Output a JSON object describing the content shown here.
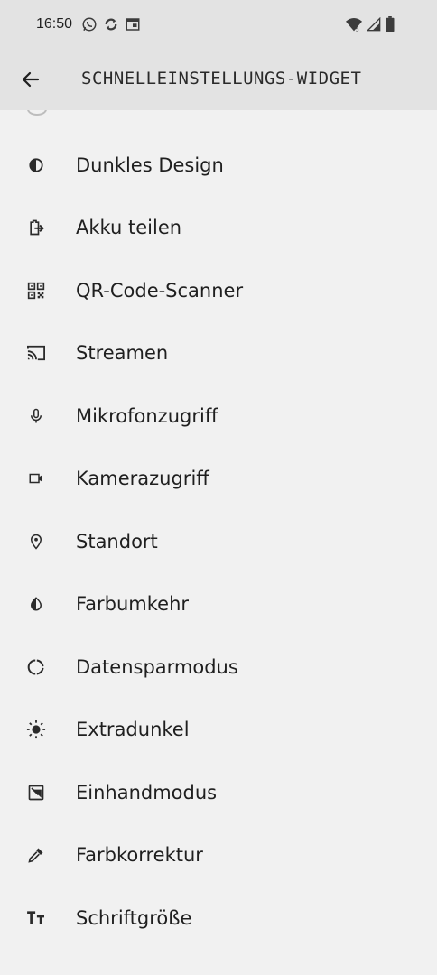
{
  "status_bar": {
    "time": "16:50",
    "left_icons": [
      "whatsapp-icon",
      "sync-icon",
      "calendar-icon"
    ],
    "right_icons": [
      "wifi-5-icon",
      "signal-icon",
      "battery-icon"
    ]
  },
  "header": {
    "title": "SCHNELLEINSTELLUNGS-WIDGET",
    "back_icon": "arrow-back-icon"
  },
  "items": [
    {
      "label": "Dunkles Design",
      "icon": "dark-theme-icon"
    },
    {
      "label": "Akku teilen",
      "icon": "battery-share-icon"
    },
    {
      "label": "QR-Code-Scanner",
      "icon": "qr-scanner-icon"
    },
    {
      "label": "Streamen",
      "icon": "cast-icon"
    },
    {
      "label": "Mikrofonzugriff",
      "icon": "microphone-icon"
    },
    {
      "label": "Kamerazugriff",
      "icon": "camera-icon"
    },
    {
      "label": "Standort",
      "icon": "location-icon"
    },
    {
      "label": "Farbumkehr",
      "icon": "color-inversion-icon"
    },
    {
      "label": "Datensparmodus",
      "icon": "data-saver-icon"
    },
    {
      "label": "Extradunkel",
      "icon": "extra-dim-icon"
    },
    {
      "label": "Einhandmodus",
      "icon": "one-handed-mode-icon"
    },
    {
      "label": "Farbkorrektur",
      "icon": "color-correction-icon"
    },
    {
      "label": "Schriftgröße",
      "icon": "font-size-icon"
    }
  ]
}
